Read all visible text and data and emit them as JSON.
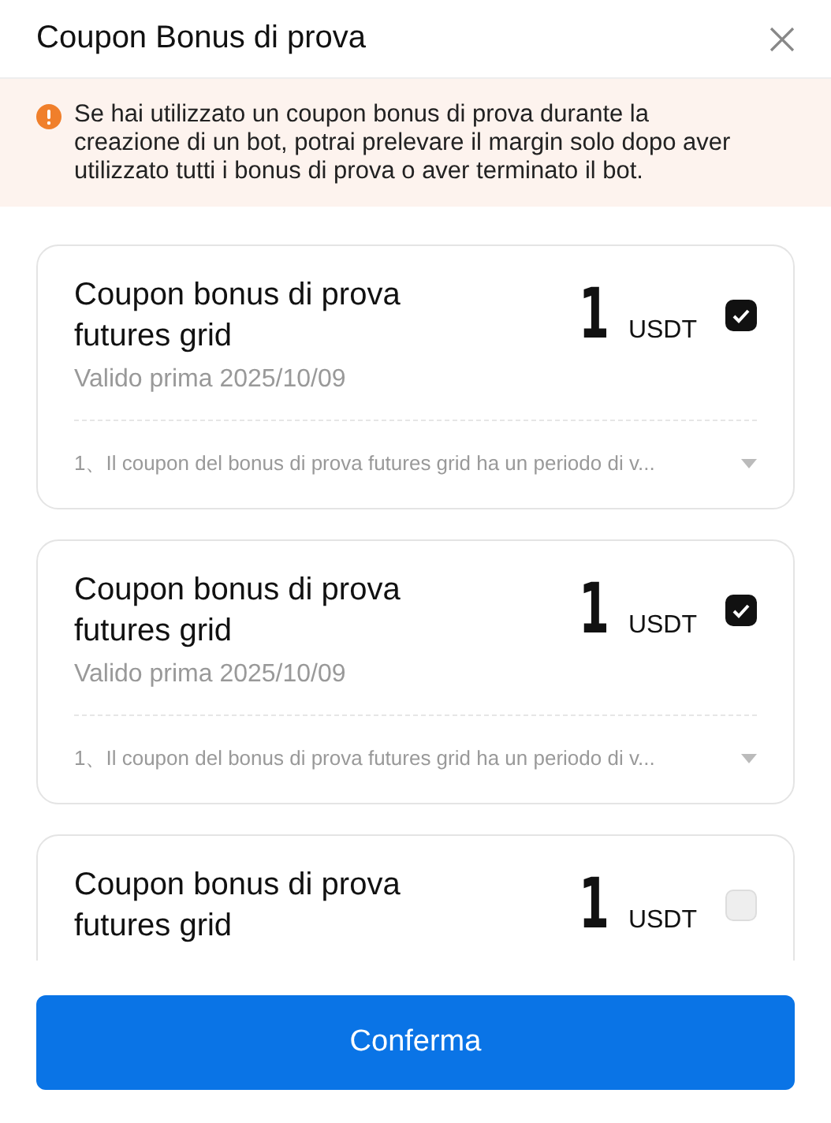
{
  "title": "Coupon Bonus di prova",
  "notice": "Se hai utilizzato un coupon bonus di prova durante la creazione di un bot, potrai prelevare il margin solo dopo aver utilizzato tutti i bonus di prova o aver terminato il bot.",
  "coupons": [
    {
      "name": "Coupon bonus di prova futures grid",
      "amount": "1",
      "unit": "USDT",
      "checked": true,
      "validity": "Valido prima 2025/10/09",
      "terms": "1、Il coupon del bonus di prova futures grid ha un periodo di v..."
    },
    {
      "name": "Coupon bonus di prova futures grid",
      "amount": "1",
      "unit": "USDT",
      "checked": true,
      "validity": "Valido prima 2025/10/09",
      "terms": "1、Il coupon del bonus di prova futures grid ha un periodo di v..."
    },
    {
      "name": "Coupon bonus di prova futures grid",
      "amount": "1",
      "unit": "USDT",
      "checked": false
    }
  ],
  "confirm_button": "Conferma"
}
